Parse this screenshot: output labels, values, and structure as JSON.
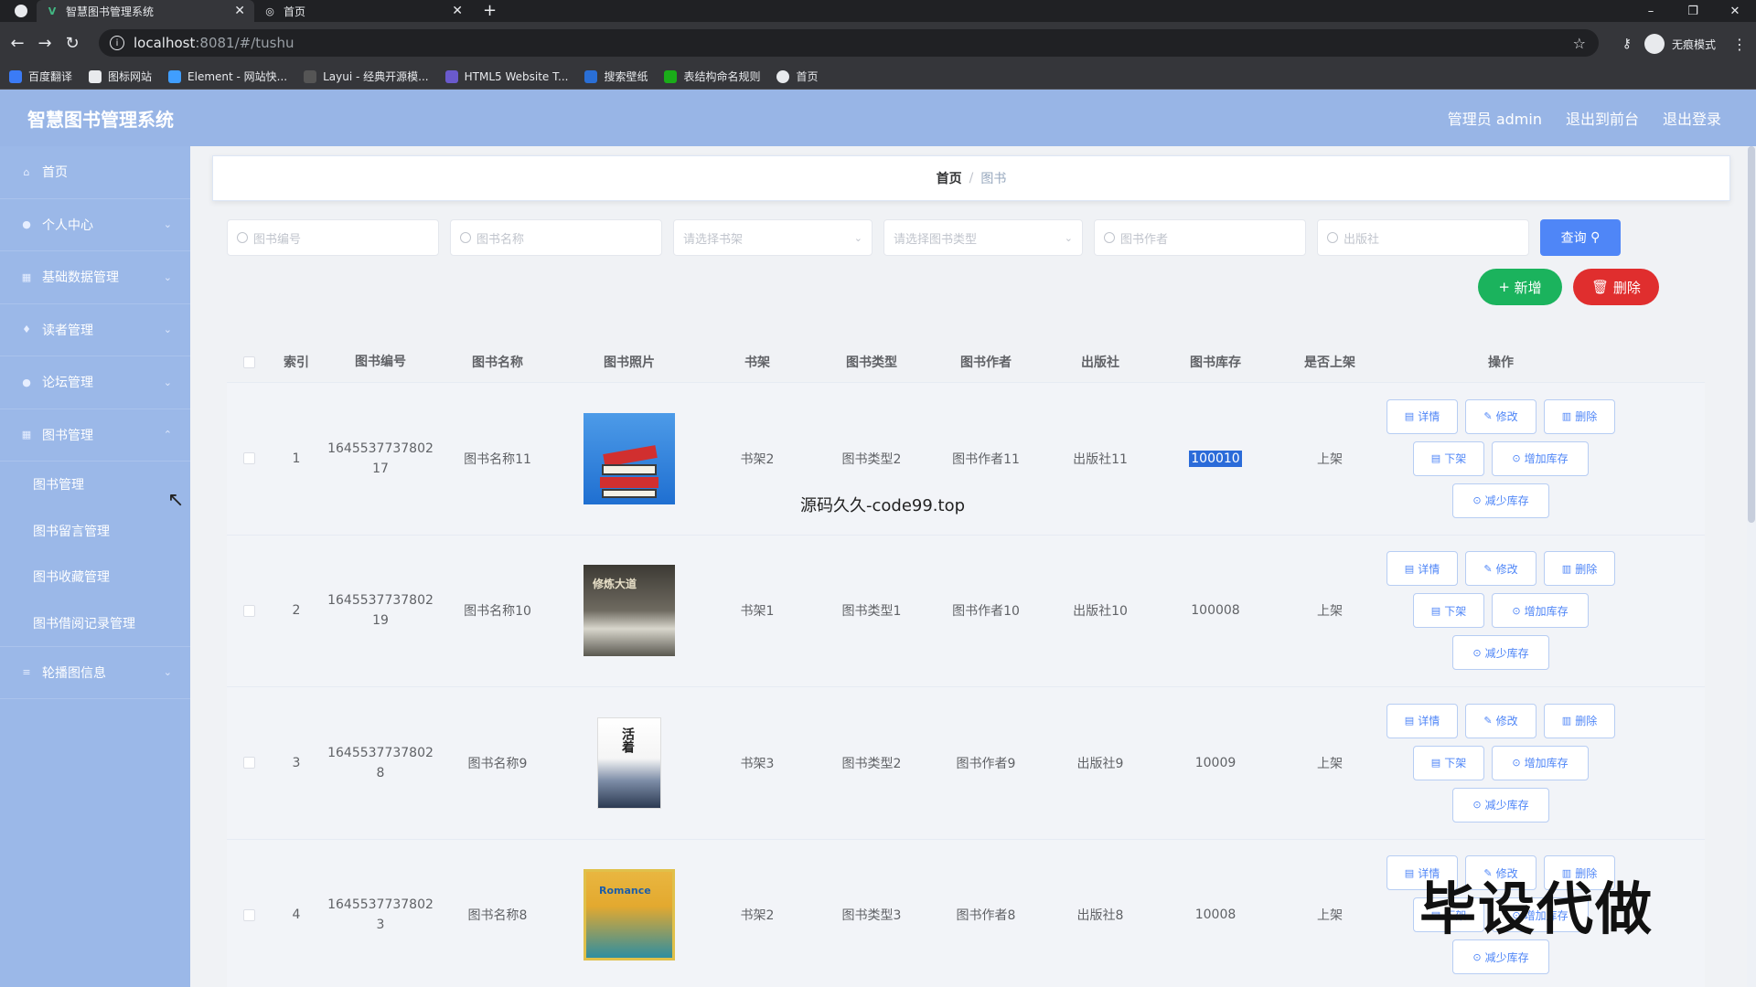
{
  "browser": {
    "tabs": [
      {
        "title": "智慧图书管理系统",
        "active": true
      },
      {
        "title": "首页",
        "active": false
      }
    ],
    "url_host": "localhost",
    "url_path": ":8081/#/tushu",
    "profile": "无痕模式",
    "bookmarks": [
      "百度翻译",
      "图标网站",
      "Element - 网站快...",
      "Layui - 经典开源模...",
      "HTML5 Website T...",
      "搜索壁纸",
      "表结构命名规则",
      "首页"
    ]
  },
  "header": {
    "title": "智慧图书管理系统",
    "user": "管理员 admin",
    "back_front": "退出到前台",
    "logout": "退出登录"
  },
  "sidebar": {
    "items": [
      {
        "label": "首页",
        "icon": "home-icon"
      },
      {
        "label": "个人中心",
        "icon": "user-icon"
      },
      {
        "label": "基础数据管理",
        "icon": "grid-icon"
      },
      {
        "label": "读者管理",
        "icon": "pin-icon"
      },
      {
        "label": "论坛管理",
        "icon": "user-icon"
      },
      {
        "label": "图书管理",
        "icon": "grid-icon"
      }
    ],
    "sub_items": [
      "图书管理",
      "图书留言管理",
      "图书收藏管理",
      "图书借阅记录管理"
    ],
    "last_item": {
      "label": "轮播图信息",
      "icon": "list-icon"
    }
  },
  "breadcrumb": {
    "home": "首页",
    "current": "图书"
  },
  "search": {
    "code_placeholder": "图书编号",
    "name_placeholder": "图书名称",
    "shelf_placeholder": "请选择书架",
    "type_placeholder": "请选择图书类型",
    "author_placeholder": "图书作者",
    "publisher_placeholder": "出版社",
    "query_label": "查询"
  },
  "actions": {
    "add": "新增",
    "delete": "删除"
  },
  "table": {
    "headers": [
      "索引",
      "图书编号",
      "图书名称",
      "图书照片",
      "书架",
      "图书类型",
      "图书作者",
      "出版社",
      "图书库存",
      "是否上架",
      "操作"
    ],
    "ops": {
      "detail": "详情",
      "edit": "修改",
      "delete": "删除",
      "offshelf": "下架",
      "add_stock": "增加库存",
      "reduce_stock": "减少库存"
    },
    "rows": [
      {
        "index": "1",
        "code1": "1645537737802",
        "code2": "17",
        "name": "图书名称11",
        "cover_text": "",
        "shelf": "书架2",
        "type": "图书类型2",
        "author": "图书作者11",
        "publisher": "出版社11",
        "stock": "100010",
        "status": "上架"
      },
      {
        "index": "2",
        "code1": "1645537737802",
        "code2": "19",
        "name": "图书名称10",
        "cover_text": "修炼大道",
        "shelf": "书架1",
        "type": "图书类型1",
        "author": "图书作者10",
        "publisher": "出版社10",
        "stock": "100008",
        "status": "上架"
      },
      {
        "index": "3",
        "code1": "1645537737802",
        "code2": "8",
        "name": "图书名称9",
        "cover_text": "活着",
        "shelf": "书架3",
        "type": "图书类型2",
        "author": "图书作者9",
        "publisher": "出版社9",
        "stock": "10009",
        "status": "上架"
      },
      {
        "index": "4",
        "code1": "1645537737802",
        "code2": "3",
        "name": "图书名称8",
        "cover_text": "Romance",
        "shelf": "书架2",
        "type": "图书类型3",
        "author": "图书作者8",
        "publisher": "出版社8",
        "stock": "10008",
        "status": "上架"
      }
    ]
  },
  "watermarks": {
    "source": "源码久久-code99.top",
    "promo": "毕设代做"
  },
  "colors": {
    "header_bg": "#98b5e6",
    "sidebar_bg": "#9bb8e8",
    "primary": "#4f86f7",
    "success": "#1bb35d",
    "danger": "#e02e2e"
  }
}
